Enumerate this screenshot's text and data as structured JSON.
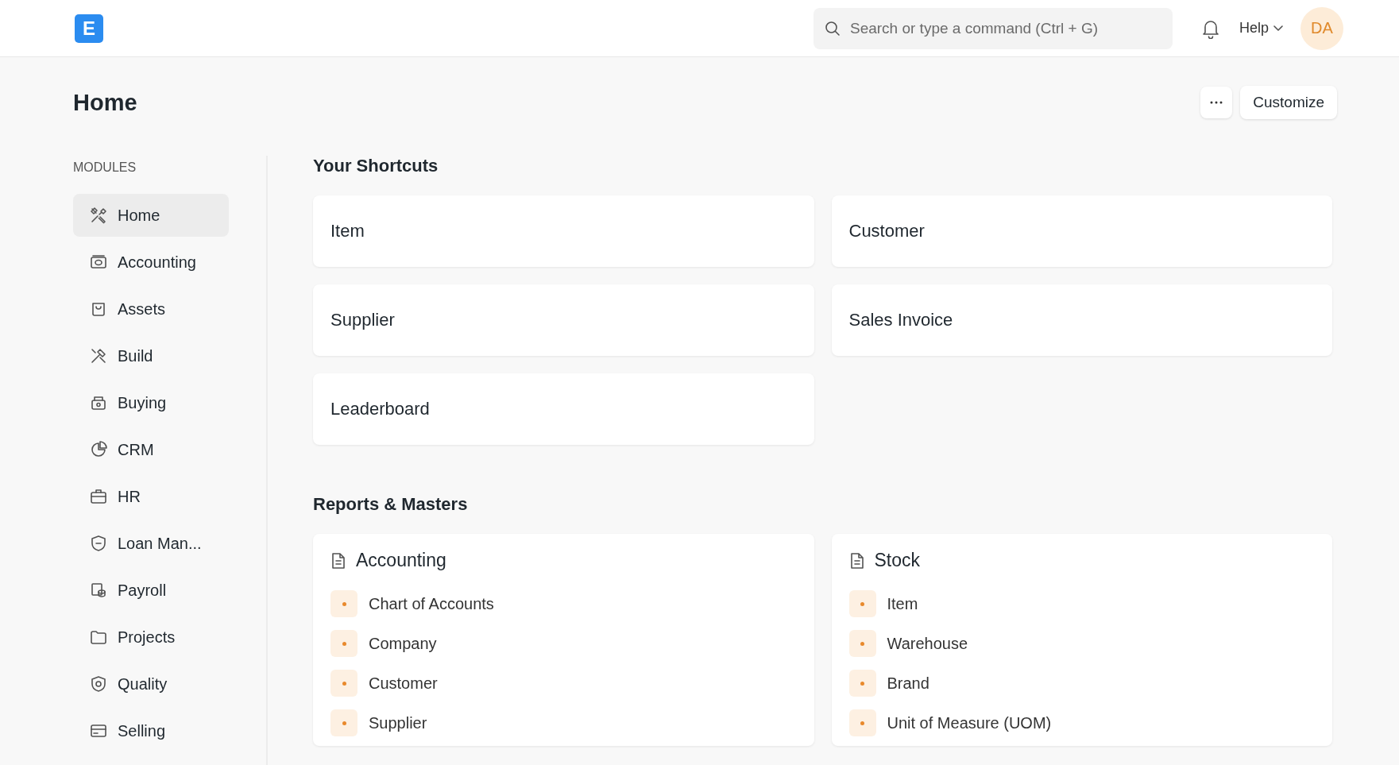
{
  "navbar": {
    "logo": "E",
    "search": {
      "placeholder": "Search or type a command (Ctrl + G)"
    },
    "help": "Help",
    "avatar": "DA"
  },
  "page": {
    "title": "Home",
    "customize": "Customize"
  },
  "sidebar": {
    "heading": "MODULES",
    "items": [
      {
        "label": "Home",
        "selected": true
      },
      {
        "label": "Accounting",
        "selected": false
      },
      {
        "label": "Assets",
        "selected": false
      },
      {
        "label": "Build",
        "selected": false
      },
      {
        "label": "Buying",
        "selected": false
      },
      {
        "label": "CRM",
        "selected": false
      },
      {
        "label": "HR",
        "selected": false
      },
      {
        "label": "Loan Man...",
        "selected": false
      },
      {
        "label": "Payroll",
        "selected": false
      },
      {
        "label": "Projects",
        "selected": false
      },
      {
        "label": "Quality",
        "selected": false
      },
      {
        "label": "Selling",
        "selected": false
      }
    ]
  },
  "shortcuts": {
    "heading": "Your Shortcuts",
    "items": [
      "Item",
      "Customer",
      "Supplier",
      "Sales Invoice",
      "Leaderboard"
    ]
  },
  "reports": {
    "heading": "Reports & Masters",
    "cards": [
      {
        "title": "Accounting",
        "links": [
          "Chart of Accounts",
          "Company",
          "Customer",
          "Supplier"
        ]
      },
      {
        "title": "Stock",
        "links": [
          "Item",
          "Warehouse",
          "Brand",
          "Unit of Measure (UOM)"
        ]
      }
    ]
  }
}
